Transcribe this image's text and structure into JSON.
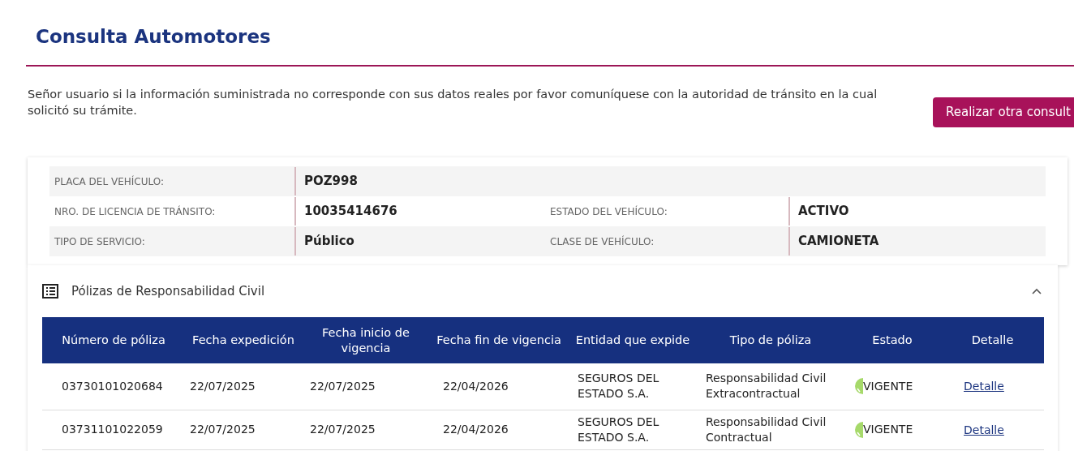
{
  "title": "Consulta Automotores",
  "notice": "Señor usuario si la información suministrada no corresponde con sus datos reales por favor comuníquese con la autoridad de tránsito en la cual solicitó su trámite.",
  "action_button": "Realizar otra consult",
  "vehicle": [
    {
      "label": "PLACA DEL VEHÍCULO:",
      "value": "POZ998"
    },
    {
      "label": "NRO. DE LICENCIA DE TRÁNSITO:",
      "value": "10035414676",
      "label_2": "ESTADO DEL VEHÍCULO:",
      "value_2": "ACTIVO"
    },
    {
      "label": "TIPO DE SERVICIO:",
      "value": "Público",
      "label_2": "CLASE DE VEHÍCULO:",
      "value_2": "CAMIONETA"
    }
  ],
  "policies": {
    "title": "Pólizas de Responsabilidad Civil",
    "expanded": true,
    "columns": [
      "Número de póliza",
      "Fecha expedición",
      "Fecha inicio de vigencia",
      "Fecha fin de vigencia",
      "Entidad que expide",
      "Tipo de póliza",
      "Estado",
      "Detalle"
    ],
    "rows": [
      {
        "number": "03730101020684",
        "issued": "22/07/2025",
        "start": "22/07/2025",
        "end": "22/04/2026",
        "issuer": "SEGUROS DEL ESTADO S.A.",
        "type": "Responsabilidad Civil Extracontractual",
        "status": "VIGENTE",
        "detail": "Detalle"
      },
      {
        "number": "03731101022059",
        "issued": "22/07/2025",
        "start": "22/07/2025",
        "end": "22/04/2026",
        "issuer": "SEGUROS DEL ESTADO S.A.",
        "type": "Responsabilidad Civil Contractual",
        "status": "VIGENTE",
        "detail": "Detalle"
      }
    ]
  }
}
